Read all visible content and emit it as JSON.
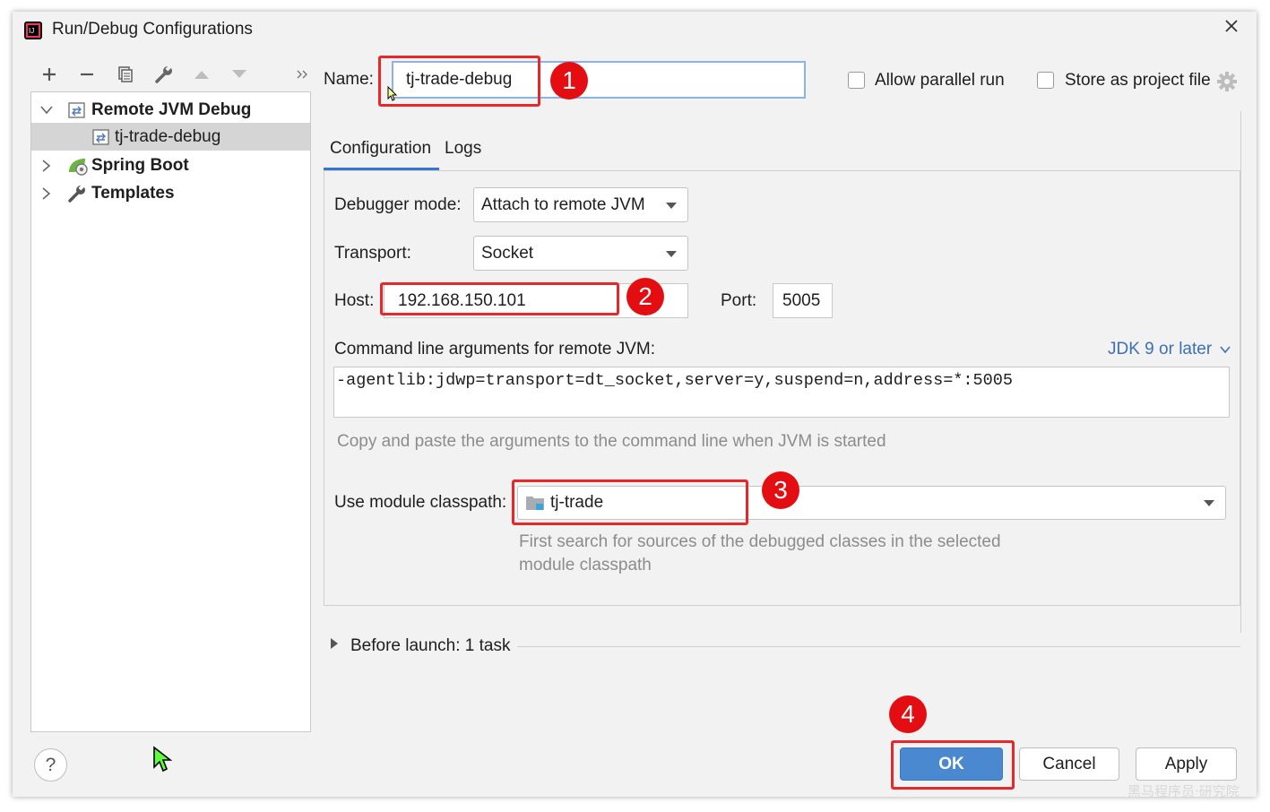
{
  "window": {
    "title": "Run/Debug Configurations"
  },
  "toolbar": {
    "icons": [
      "plus-icon",
      "minus-icon",
      "copy-icon",
      "wrench-icon",
      "arrow-up-icon",
      "arrow-down-icon",
      "more-icon"
    ]
  },
  "tree": {
    "items": [
      {
        "label": "Remote JVM Debug",
        "expanded": true
      },
      {
        "label": "tj-trade-debug",
        "selected": true
      },
      {
        "label": "Spring Boot",
        "expanded": false
      },
      {
        "label": "Templates",
        "expanded": false
      }
    ]
  },
  "header": {
    "name_label": "Name:",
    "name_value": "tj-trade-debug",
    "allow_parallel_label": "Allow parallel run",
    "store_project_label": "Store as project file"
  },
  "tabs": [
    {
      "label": "Configuration",
      "active": true
    },
    {
      "label": "Logs",
      "active": false
    }
  ],
  "config": {
    "debugger_mode_label": "Debugger mode:",
    "debugger_mode_value": "Attach to remote JVM",
    "transport_label": "Transport:",
    "transport_value": "Socket",
    "host_label": "Host:",
    "host_value": "192.168.150.101",
    "port_label": "Port:",
    "port_value": "5005",
    "cmd_label": "Command line arguments for remote JVM:",
    "jdk_link": "JDK 9 or later",
    "cmd_value": "-agentlib:jdwp=transport=dt_socket,server=y,suspend=n,address=*:5005",
    "cmd_hint": "Copy and paste the arguments to the command line when JVM is started",
    "module_label": "Use module classpath:",
    "module_value": "tj-trade",
    "module_hint_line1": "First search for sources of the debugged classes in the selected",
    "module_hint_line2": "module classpath"
  },
  "before_launch": {
    "label": "Before launch: 1 task"
  },
  "buttons": {
    "ok": "OK",
    "cancel": "Cancel",
    "apply": "Apply",
    "help": "?"
  },
  "annotations": [
    "1",
    "2",
    "3",
    "4"
  ],
  "watermark": "黑马程序员·研究院",
  "colors": {
    "accent": "#3874d8",
    "annotation_red": "#e30d12",
    "ok_blue": "#4a88cf",
    "link": "#3d6fb8"
  }
}
